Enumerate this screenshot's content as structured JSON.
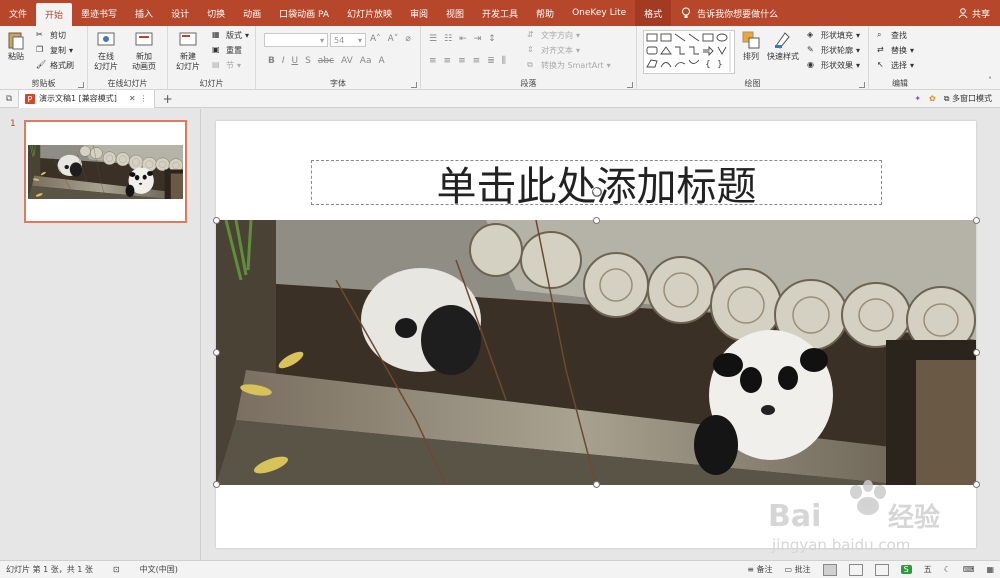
{
  "tabs": [
    "文件",
    "开始",
    "墨迹书写",
    "插入",
    "设计",
    "切换",
    "动画",
    "口袋动画 PA",
    "幻灯片放映",
    "审阅",
    "视图",
    "开发工具",
    "帮助",
    "OneKey Lite",
    "格式"
  ],
  "tell_me": "告诉我你想要做什么",
  "share": "共享",
  "ribbon": {
    "clipboard": {
      "paste": "粘贴",
      "cut": "剪切",
      "copy": "复制",
      "format_painter": "格式刷",
      "label": "剪贴板"
    },
    "online_slides": {
      "online_slide": "在线\n幻灯片",
      "new_anim": "新加\n动画页",
      "label": "在线幻灯片"
    },
    "slides": {
      "new_slide": "新建\n幻灯片",
      "layout": "版式",
      "reset": "重置",
      "section": "节",
      "label": "幻灯片"
    },
    "font": {
      "font_size": "54",
      "label": "字体"
    },
    "paragraph": {
      "text_direction": "文字方向",
      "align_text": "对齐文本",
      "smartart": "转换为 SmartArt",
      "label": "段落"
    },
    "drawing": {
      "arrange": "排列",
      "quick_styles": "快速样式",
      "shape_fill": "形状填充",
      "shape_outline": "形状轮廓",
      "shape_effects": "形状效果",
      "label": "绘图"
    },
    "editing": {
      "find": "查找",
      "replace": "替换",
      "select": "选择",
      "label": "编辑"
    }
  },
  "doc_tab": {
    "title": "演示文稿1 [兼容模式]"
  },
  "multi_window": "多窗口模式",
  "thumbnail": {
    "number": "1"
  },
  "slide": {
    "title_placeholder": "单击此处添加标题"
  },
  "status": {
    "slide_info": "幻灯片 第 1 张，共 1 张",
    "language": "中文(中国)",
    "notes": "备注",
    "comments": "批注",
    "ime": "五"
  },
  "watermark": {
    "text1": "Bai",
    "text2": "经验",
    "url": "jingyan.baidu.com"
  },
  "colors": {
    "accent": "#b7472a",
    "thumb_border": "#e07a5f"
  }
}
